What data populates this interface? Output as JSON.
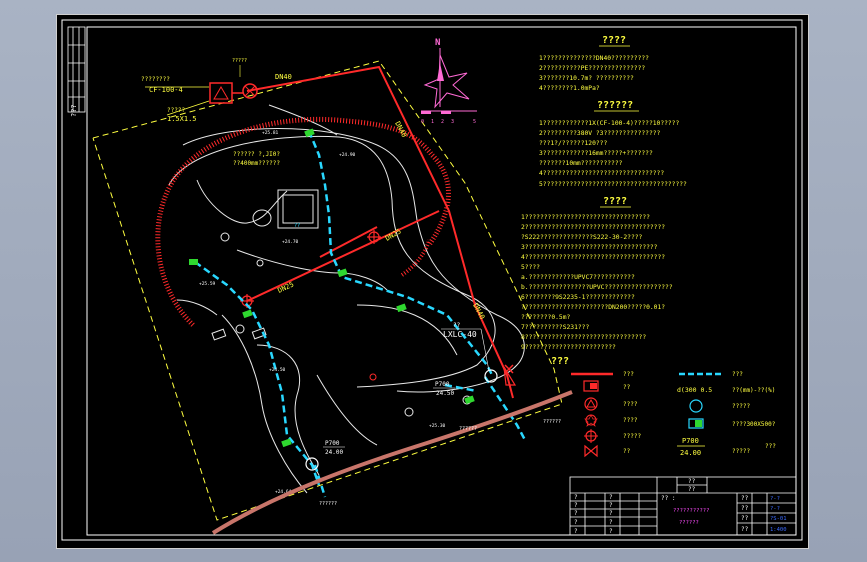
{
  "side_label": "???",
  "compass": {
    "north_letter": "N",
    "scale_ticks": [
      "0",
      "1",
      "2",
      "3",
      "5"
    ]
  },
  "plan": {
    "equipment_tag": "CF-100-4",
    "equipment_qty": "????????",
    "box_label": "?????",
    "box_size": "1.5X1.5",
    "pipe_dn40_top": "DN40",
    "pipe_dn40_right": "DN40",
    "pipe_dn40_lower": "DN40",
    "pipe_dn25_a": "DN25",
    "pipe_dn25_b": "DN25",
    "top_marker": "?????",
    "spacing_note": "?????? ?,JI0?",
    "spacing_note2": "??400mm??????",
    "building_text": "??",
    "elev_a": "+25.81",
    "elev_b": "+24.90",
    "elev_c": "+25.59",
    "elev_d": "+24.50",
    "elev_e": "+24.70",
    "elev_f": "+25.30",
    "elev_g": "+24.64",
    "well_code": "??",
    "well_type": "LXLC-40",
    "valve_a_top": "P700",
    "valve_a_bottom": "24.50",
    "valve_b_top": "P700",
    "valve_b_bottom": "24.00",
    "outlet_a": "??????",
    "outlet_b": "??????",
    "outlet_c": "??????"
  },
  "notes": {
    "title_1": "????",
    "block_1": [
      "1??????????????DN40??????????",
      "2??????????PE???????????????",
      "3???????10.7m? ??????????",
      "4????????1.0mPa?"
    ],
    "title_2": "??????",
    "block_2": [
      "1????????????1X(CF-100-4)?????10?????",
      "2?????????380V ?3???????????????",
      "   ???1?/??????120???",
      "3????????????16mm?????+???????",
      "   ???????10mm???????????",
      "4????????????????????????????????",
      "5??????????????????????????????????????"
    ],
    "title_3": "????",
    "block_3": [
      "1?????????????????????????????????",
      "2?????????????????????????????????????",
      "  ?S222??????????????S222-30-2????",
      "3???????????????????????????????????",
      "4?????????????????????????????????????",
      "5????",
      "   a.????????????UPVC7???????????",
      "   b.????????????????UPVC??????????????????",
      "6????????9S2235-1?????????????",
      "   ???????????????????????DN200?????0.01?",
      "   ????????0.5m?",
      "7??????????S231???",
      "8????????????????????????????????",
      "9????????????????????????"
    ]
  },
  "legend": {
    "title": "???",
    "items_left": [
      {
        "label": "???"
      },
      {
        "label": "??"
      },
      {
        "label": "????"
      },
      {
        "label": "????"
      },
      {
        "label": "?????"
      },
      {
        "label": "??"
      }
    ],
    "items_right": [
      {
        "symbol_text": "d(300  0.5",
        "label": "???"
      },
      {
        "label": "??(mm)-??(%)"
      },
      {
        "label": "?????"
      },
      {
        "label": "????300X500?"
      },
      {
        "symbol_top": "P700",
        "symbol_bottom": "24.00",
        "label": "?????"
      },
      {
        "label": "???"
      }
    ]
  },
  "title_block": {
    "header_top": "??",
    "header_bottom": "??",
    "left_col": [
      "?",
      "?",
      "?",
      "?",
      "?"
    ],
    "mid_col": [
      "?",
      "?",
      "?",
      "?",
      "?"
    ],
    "project_label": "?? :",
    "drawing_name": "???????????",
    "drawing_sub": "??????",
    "right_labels": [
      "??",
      "??",
      "??",
      "??"
    ],
    "right_values": [
      "?-?",
      "?-?",
      "?S-01",
      "1:400"
    ]
  },
  "colors": {
    "red": "#ff2a2a",
    "cyan": "#29d8ff",
    "yellow": "#ffff40",
    "white": "#ffffff",
    "green": "#2fd82f",
    "pink": "#c8756a",
    "blue": "#3b6bff"
  }
}
